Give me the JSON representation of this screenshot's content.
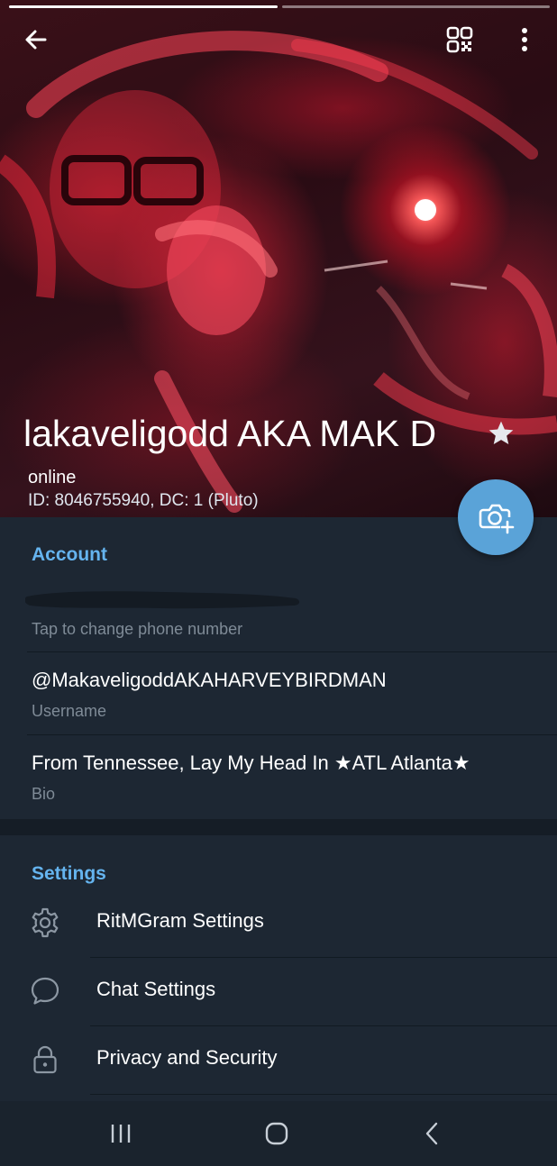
{
  "header": {
    "story_segments": [
      true,
      false
    ],
    "back_icon": "arrow-left-icon",
    "qr_icon": "qr-code-icon",
    "menu_icon": "more-vertical-icon",
    "display_name": "lakaveligodd AKA MAK D",
    "name_badge_icon": "star-icon",
    "status": "online",
    "id_line": "ID: 8046755940, DC: 1 (Pluto)",
    "camera_icon": "camera-add-icon"
  },
  "account": {
    "title": "Account",
    "phone_hint": "Tap to change phone number",
    "username": "@MakaveligoddAKAHARVEYBIRDMAN",
    "username_label": "Username",
    "bio": "From Tennessee, Lay My Head In ★ATL Atlanta★",
    "bio_label": "Bio"
  },
  "settings": {
    "title": "Settings",
    "items": [
      {
        "label": "RitMGram Settings",
        "icon": "gear-icon"
      },
      {
        "label": "Chat Settings",
        "icon": "chat-bubble-icon"
      },
      {
        "label": "Privacy and Security",
        "icon": "lock-icon"
      }
    ]
  },
  "nav": {
    "recents_icon": "recent-apps-icon",
    "home_icon": "home-icon",
    "back_icon": "nav-back-icon"
  },
  "colors": {
    "accent": "#65b4ef",
    "fab": "#5aa3d8",
    "background": "#1d2733",
    "secondary_text": "#7f8b97"
  }
}
